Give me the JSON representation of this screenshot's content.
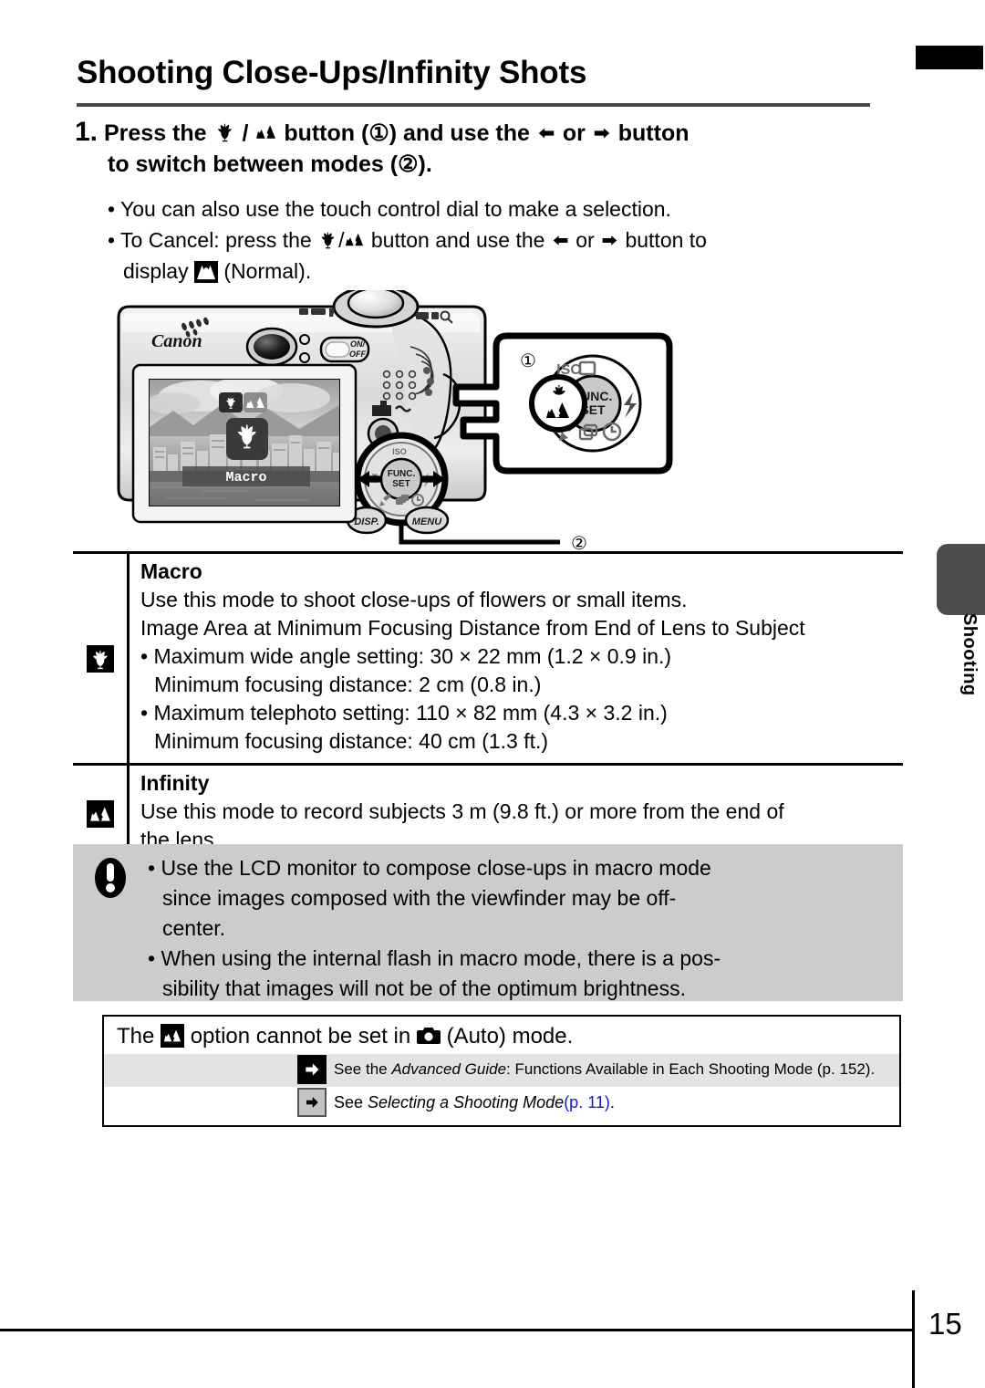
{
  "page": {
    "title": "Shooting Close-Ups/Infinity Shots",
    "number": "15",
    "side_tab_label": "Shooting"
  },
  "step": {
    "number": "1.",
    "line1_a": "Press the",
    "line1_icon_macro": "macro-tulip-icon",
    "line1_slash": "/",
    "line1_icon_infinity": "infinity-mountain-icon",
    "line1_b": "button (",
    "line1_circle1": "①",
    "line1_c": ") and use the",
    "line1_left_arrow": "left-arrow-icon",
    "line1_or": "or",
    "line1_right_arrow": "right-arrow-icon",
    "line1_d": "button",
    "line2_a": "to switch between modes (",
    "line2_circle2": "②",
    "line2_b": ")."
  },
  "bullets": [
    {
      "text": "You can also use the touch control dial to make a selection."
    },
    {
      "pre": "To Cancel: press the",
      "mid": "button and use the",
      "post": "button to",
      "cont_pre": "display",
      "cont_post": "(Normal)."
    }
  ],
  "illustration": {
    "brand": "Canon",
    "power_label": "ON/\nOFF",
    "func_set_label": "FUNC.\nSET",
    "disp_label": "DISP.",
    "menu_label": "MENU",
    "iso_label": "ISO",
    "lcd_mode_text": "Macro",
    "callout_1": "①",
    "callout_2": "②"
  },
  "table": {
    "rows": [
      {
        "icon": "macro-tulip-icon",
        "header": "Macro",
        "lines": [
          {
            "type": "plain",
            "text": "Use this mode to shoot close-ups of flowers or small items."
          },
          {
            "type": "plain",
            "text": "Image Area at Minimum Focusing Distance from End of Lens to Subject"
          },
          {
            "type": "bullet",
            "text": "Maximum wide angle setting: 30 × 22 mm (1.2 × 0.9 in.)"
          },
          {
            "type": "sub",
            "text": "Minimum focusing distance: 2 cm (0.8 in.)"
          },
          {
            "type": "bullet",
            "text": "Maximum telephoto setting: 110 × 82 mm (4.3 × 3.2 in.)"
          },
          {
            "type": "sub",
            "text": "Minimum focusing distance: 40 cm (1.3 ft.)"
          }
        ]
      },
      {
        "icon": "infinity-mountain-icon",
        "header": "Infinity",
        "lines": [
          {
            "type": "plain",
            "text": "Use this mode to record subjects 3 m (9.8 ft.) or more from the end of"
          },
          {
            "type": "plain",
            "text": "the lens."
          }
        ]
      }
    ]
  },
  "caution": {
    "icon": "exclamation-icon",
    "items": [
      {
        "line1": "Use the LCD monitor to compose close-ups in macro mode",
        "line2": "since images composed with the viewfinder may be off-",
        "line3": "center."
      },
      {
        "line1": "When using the internal flash in macro mode, there is a pos-",
        "line2": "sibility that images will not be of the optimum brightness.",
        "line3": ""
      }
    ]
  },
  "note": {
    "lead_a": "The",
    "lead_icon": "infinity-mountain-icon",
    "lead_b": "option cannot be set in",
    "lead_camera_icon": "camera-auto-icon",
    "lead_c": "(Auto) mode.",
    "references": [
      {
        "arrow": "arrow-right-icon",
        "arrow_style": "black",
        "plain_1": "See the ",
        "italic_1": "Advanced Guide",
        "plain_2": ": Functions Available in Each Shooting Mode (p. 152)."
      },
      {
        "arrow": "arrow-right-icon",
        "arrow_style": "grey",
        "plain_1": "See ",
        "italic_1": "Selecting a Shooting Mode",
        "link": "(p. 11)",
        "plain_2": "."
      }
    ]
  },
  "colors": {
    "link": "#1616d8",
    "caution_bg": "#cccccc",
    "side_tab": "#4d4d4d",
    "ref_row_bg": "#e3e3e3"
  }
}
